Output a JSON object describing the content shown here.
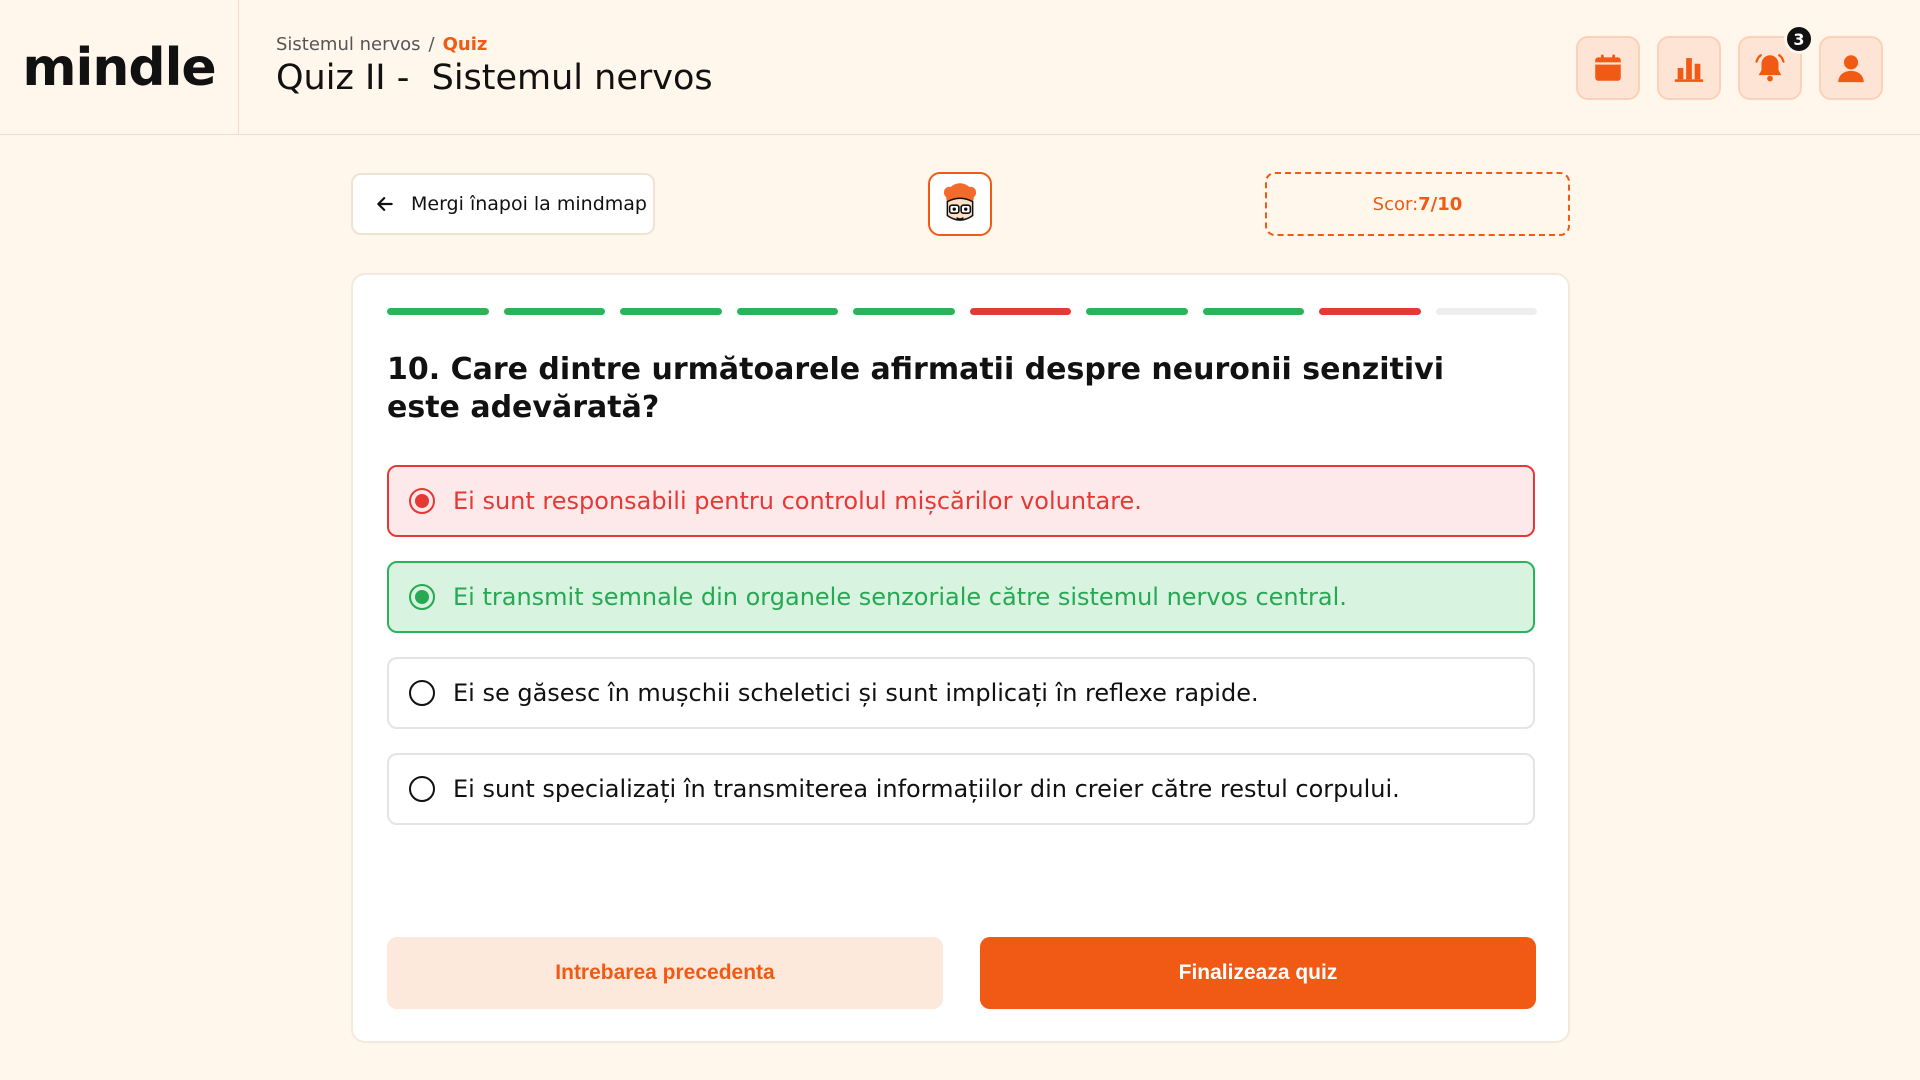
{
  "brand": {
    "logo": "mindle"
  },
  "header": {
    "breadcrumb": {
      "parent": "Sistemul nervos",
      "separator": "/",
      "current": "Quiz"
    },
    "title": "Quiz II -  Sistemul nervos",
    "icons": [
      "calendar-icon",
      "chart-icon",
      "bell-icon",
      "user-icon"
    ],
    "notifications_count": "3"
  },
  "nav": {
    "back_label": "Mergi înapoi la mindmap"
  },
  "score": {
    "label": "Scor: ",
    "value": "7/10"
  },
  "progress": [
    "correct",
    "correct",
    "correct",
    "correct",
    "correct",
    "wrong",
    "correct",
    "correct",
    "wrong",
    "pending"
  ],
  "colors": {
    "accent": "#f05a14",
    "correct": "#2bb35a",
    "wrong": "#e53935",
    "pending": "#eeeeee"
  },
  "question": {
    "text": "10. Care dintre următoarele afirmatii despre neuronii senzitivi este adevărată?",
    "options": [
      {
        "text": "Ei sunt responsabili pentru controlul mișcărilor voluntare.",
        "state": "wrong"
      },
      {
        "text": "Ei transmit semnale din organele senzoriale către sistemul nervos central.",
        "state": "correct"
      },
      {
        "text": "Ei se găsesc în mușchii scheletici și sunt implicați în reflexe rapide.",
        "state": "none"
      },
      {
        "text": "Ei sunt specializați în transmiterea informațiilor din creier către restul corpului.",
        "state": "none"
      }
    ]
  },
  "actions": {
    "previous_label": "Intrebarea precedenta",
    "finish_label": "Finalizeaza quiz"
  }
}
